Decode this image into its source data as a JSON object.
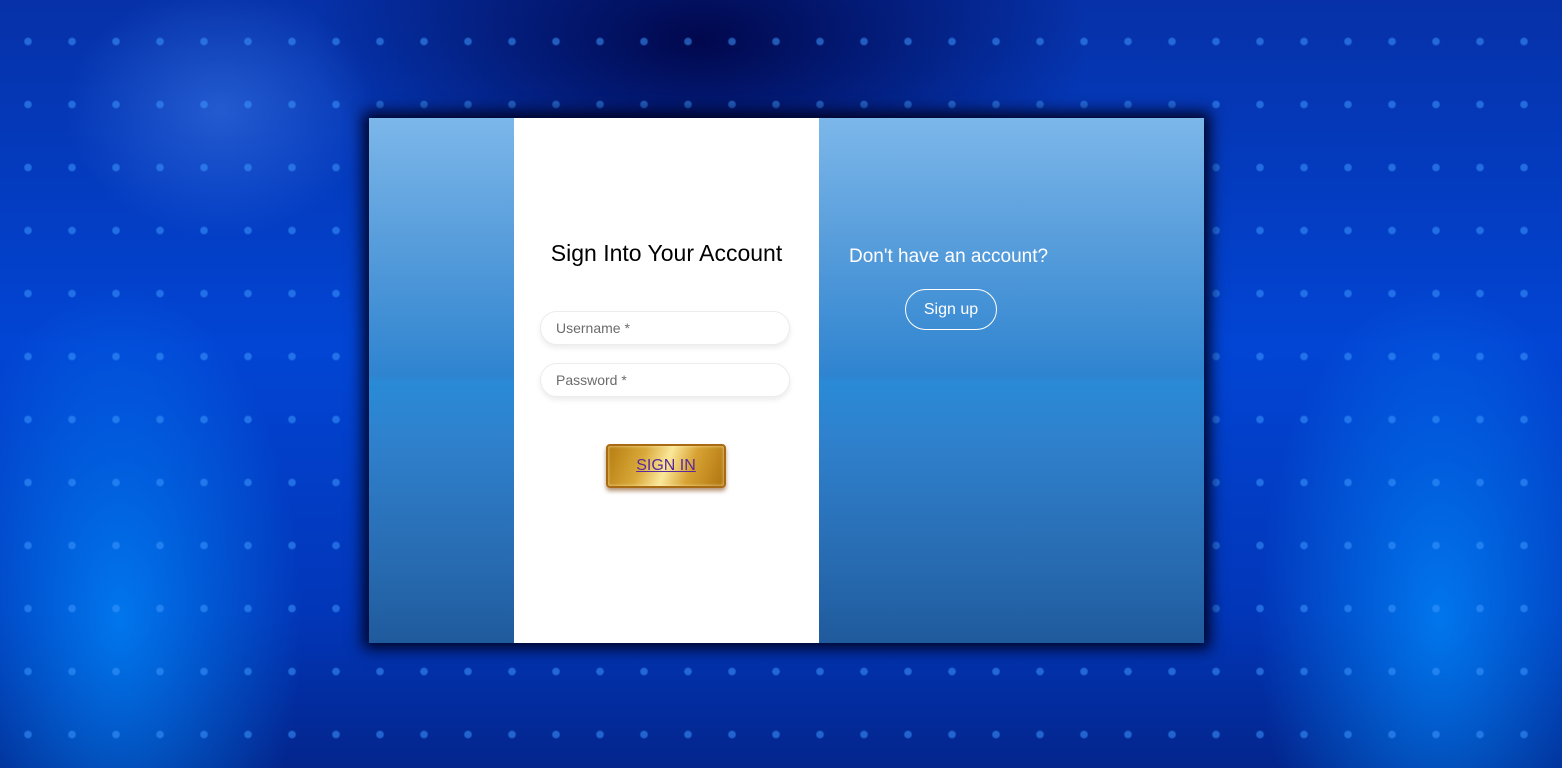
{
  "signin": {
    "title": "Sign Into Your Account",
    "username_placeholder": "Username *",
    "password_placeholder": "Password *",
    "button_label": "SIGN IN"
  },
  "signup": {
    "prompt": "Don't have an account?",
    "button_label": "Sign up"
  },
  "colors": {
    "background": "#0245d4",
    "card_gradient_top": "#7cb7ea",
    "card_gradient_bottom": "#1f5a9c",
    "panel": "#ffffff",
    "signin_button_gold": "#d9a93a",
    "signin_button_text": "#5a2a9a"
  }
}
